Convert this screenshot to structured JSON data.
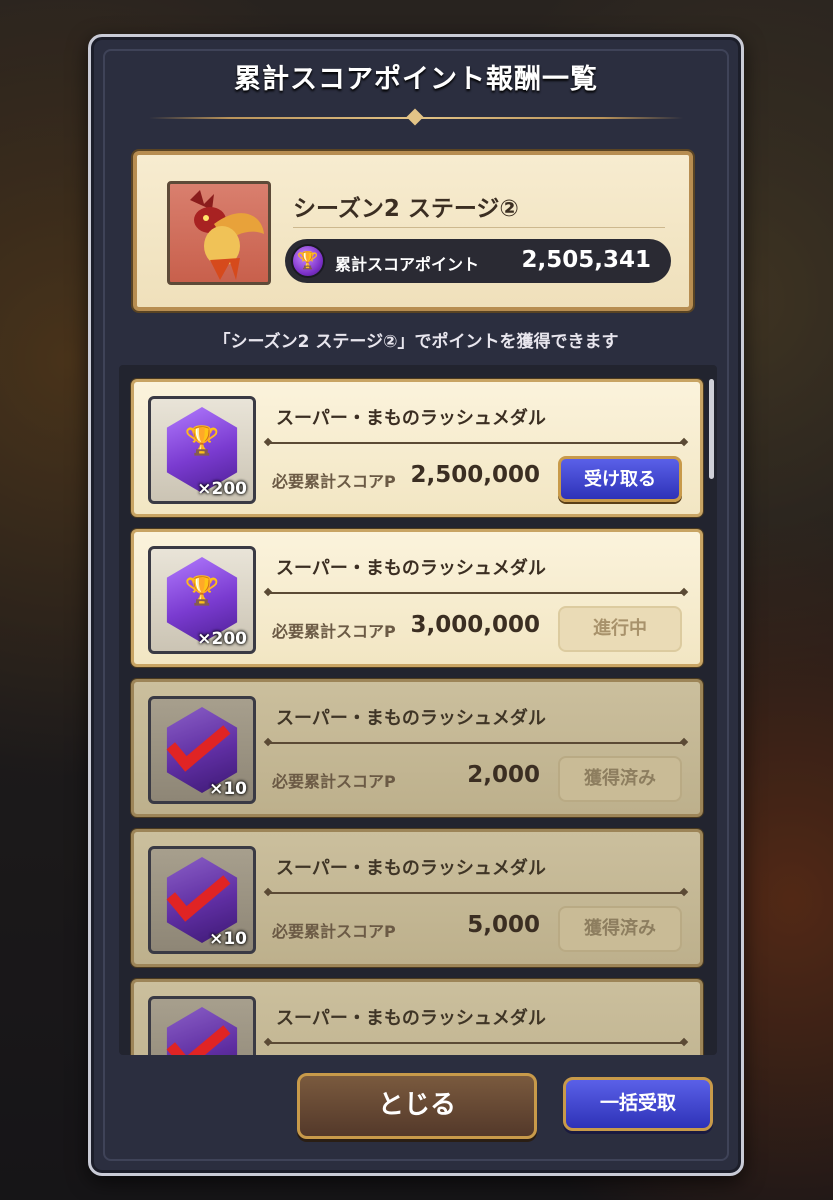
{
  "dialog": {
    "title": "累計スコアポイント報酬一覧"
  },
  "stage": {
    "name": "シーズン2 ステージ②",
    "score_label": "累計スコアポイント",
    "score_value": "2,505,341",
    "info": "「シーズン2 ステージ②」でポイントを獲得できます"
  },
  "rewards": [
    {
      "name": "スーパー・まものラッシュメダル",
      "quantity": "×200",
      "req_label": "必要累計スコアP",
      "req_value": "2,500,000",
      "button": "受け取る",
      "state": "claimable"
    },
    {
      "name": "スーパー・まものラッシュメダル",
      "quantity": "×200",
      "req_label": "必要累計スコアP",
      "req_value": "3,000,000",
      "button": "進行中",
      "state": "in-progress"
    },
    {
      "name": "スーパー・まものラッシュメダル",
      "quantity": "×10",
      "req_label": "必要累計スコアP",
      "req_value": "2,000",
      "button": "獲得済み",
      "state": "claimed"
    },
    {
      "name": "スーパー・まものラッシュメダル",
      "quantity": "×10",
      "req_label": "必要累計スコアP",
      "req_value": "5,000",
      "button": "獲得済み",
      "state": "claimed"
    },
    {
      "name": "スーパー・まものラッシュメダル",
      "state": "claimed"
    }
  ],
  "footer": {
    "close_label": "とじる",
    "bulk_label": "一括受取"
  },
  "colors": {
    "modal_bg": "#2b2e3f",
    "parchment": "#f7ecd0",
    "gold_border": "#c8a464",
    "claim_blue": "#2e32b8",
    "check_red": "#e02424"
  }
}
